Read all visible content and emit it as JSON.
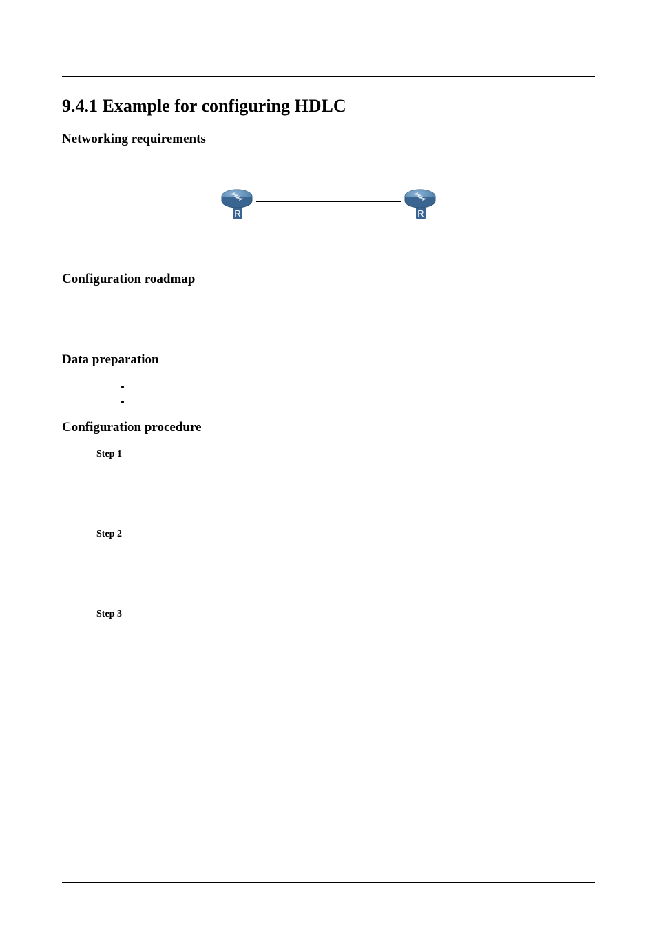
{
  "section": {
    "number": "9.4.1",
    "title": "Example for configuring HDLC"
  },
  "headings": {
    "networking": "Networking requirements",
    "roadmap": "Configuration roadmap",
    "dataprep": "Data preparation",
    "procedure": "Configuration procedure"
  },
  "diagram": {
    "left_icon": "router-icon",
    "right_icon": "router-icon",
    "label": "R"
  },
  "data_list": {
    "item1": "",
    "item2": ""
  },
  "steps": {
    "s1": "Step 1",
    "s2": "Step 2",
    "s3": "Step 3"
  }
}
